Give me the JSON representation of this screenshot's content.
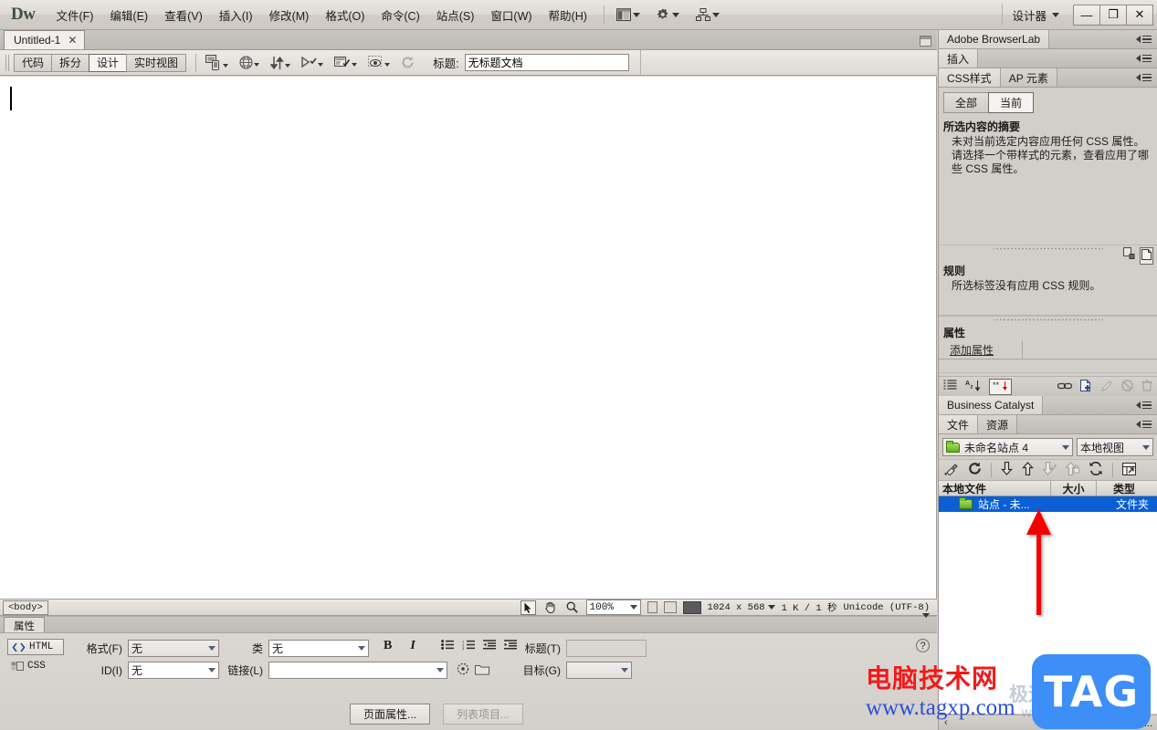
{
  "app": {
    "logo": "Dw",
    "workspace": "设计器"
  },
  "menubar": {
    "items": [
      {
        "label": "文件(F)"
      },
      {
        "label": "编辑(E)"
      },
      {
        "label": "查看(V)"
      },
      {
        "label": "插入(I)"
      },
      {
        "label": "修改(M)"
      },
      {
        "label": "格式(O)"
      },
      {
        "label": "命令(C)"
      },
      {
        "label": "站点(S)"
      },
      {
        "label": "窗口(W)"
      },
      {
        "label": "帮助(H)"
      }
    ],
    "icons": [
      "layout-switcher-icon",
      "extend-gear-icon",
      "site-setup-icon"
    ]
  },
  "window_controls": {
    "minimize": "—",
    "maximize": "❐",
    "close": "✕"
  },
  "document_tabs": [
    {
      "label": "Untitled-1",
      "close": "✕",
      "active": true
    }
  ],
  "doc_toolbar": {
    "view_buttons": [
      {
        "label": "代码",
        "active": false
      },
      {
        "label": "拆分",
        "active": false
      },
      {
        "label": "设计",
        "active": true
      },
      {
        "label": "实时视图",
        "active": false
      }
    ],
    "icons": [
      "file-management-icon",
      "preview-in-browser-icon",
      "refresh-design-view-icon",
      "view-options-icon",
      "visual-aids-icon",
      "validate-markup-icon",
      "refresh-icon"
    ],
    "title_label": "标题:",
    "title_value": "无标题文档"
  },
  "statusbar": {
    "tag_selector": "<body>",
    "tools": [
      "select-tool-icon",
      "hand-tool-icon",
      "zoom-tool-icon"
    ],
    "zoom": "100%",
    "window_sizes": [
      "phone-size-icon",
      "tablet-size-icon",
      "desktop-size-icon"
    ],
    "dimensions": "1024 x 568",
    "download": "1 K / 1 秒",
    "encoding": "Unicode (UTF-8)"
  },
  "properties_panel": {
    "tab": "属性",
    "html_button": "HTML",
    "css_button": "CSS",
    "format_label": "格式(F)",
    "format_value": "无",
    "id_label": "ID(I)",
    "id_value": "无",
    "class_label": "类",
    "class_value": "无",
    "link_label": "链接(L)",
    "link_value": "",
    "bold": "B",
    "italic": "I",
    "list_icons": [
      "unordered-list-icon",
      "ordered-list-icon",
      "outdent-icon",
      "indent-icon"
    ],
    "heading_label": "标题(T)",
    "heading_value": "",
    "target_label": "目标(G)",
    "target_value": "",
    "page_properties_button": "页面属性...",
    "list_item_button": "列表项目...",
    "help": "?"
  },
  "dock": {
    "browserlab": {
      "title": "Adobe BrowserLab"
    },
    "insert": {
      "title": "插入"
    },
    "css_panel": {
      "tabs": [
        {
          "label": "CSS样式",
          "active": true
        },
        {
          "label": "AP 元素",
          "active": false
        }
      ],
      "segments": [
        {
          "label": "全部",
          "active": false
        },
        {
          "label": "当前",
          "active": true
        }
      ],
      "summary_title": "所选内容的摘要",
      "summary_text": "未对当前选定内容应用任何 CSS 属性。请选择一个带样式的元素，查看应用了哪些 CSS 属性。",
      "rules_title": "规则",
      "rules_text": "所选标签没有应用 CSS 规则。",
      "rules_icons": [
        "rule-about-icon",
        "rule-new-icon"
      ],
      "props_title": "属性",
      "add_property": "添加属性",
      "footer_icons_left": [
        "category-view-icon",
        "list-view-icon",
        "set-properties-icon"
      ],
      "footer_icons_right": [
        "attach-stylesheet-icon",
        "new-css-rule-icon",
        "edit-rule-icon",
        "disable-property-icon",
        "delete-property-icon"
      ]
    },
    "business_catalyst": {
      "title": "Business Catalyst"
    },
    "files_panel": {
      "tabs": [
        {
          "label": "文件",
          "active": true
        },
        {
          "label": "资源",
          "active": false
        }
      ],
      "site_select": "未命名站点 4",
      "view_select": "本地视图",
      "toolbar_icons": [
        "connect-to-remote-icon",
        "refresh-icon",
        "get-files-icon",
        "put-files-icon",
        "check-out-icon",
        "check-in-icon",
        "synchronize-icon",
        "expand-panel-icon"
      ],
      "columns": [
        {
          "label": "本地文件"
        },
        {
          "label": "大小"
        },
        {
          "label": "类型"
        }
      ],
      "rows": [
        {
          "name": "站点 - 未...",
          "size": "",
          "type": "文件夹",
          "selected": true
        }
      ]
    },
    "bottom": {
      "collapse": "‹",
      "log_label": "日志..."
    }
  },
  "annotation": {
    "arrow": "red-up-arrow",
    "color": "#f40000"
  },
  "watermark": {
    "title": "电脑技术网",
    "url": "www.tagxp.com",
    "badge": "TAG",
    "faint_cn": "极速下载",
    "faint_url": "www.xz"
  }
}
